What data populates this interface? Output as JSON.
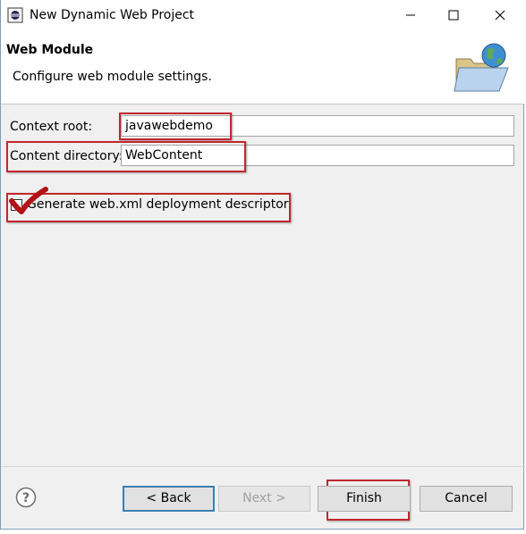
{
  "window": {
    "title": "New Dynamic Web Project"
  },
  "banner": {
    "title": "Web Module",
    "description": "Configure web module settings."
  },
  "form": {
    "context_root_label": "Context root:",
    "context_root_value": "javawebdemo",
    "content_directory_label": "Content directory:",
    "content_directory_value": "WebContent",
    "generate_xml_label": "Generate web.xml deployment descriptor",
    "generate_xml_checked": true
  },
  "buttons": {
    "back": "< Back",
    "next": "Next >",
    "finish": "Finish",
    "cancel": "Cancel"
  },
  "icons": {
    "app": "eclipse-icon",
    "minimize": "minimize-icon",
    "maximize": "maximize-icon",
    "close": "close-icon",
    "banner": "folder-globe-icon",
    "help": "help-icon"
  },
  "colors": {
    "annotation_red": "#c0272d",
    "check_red": "#b31217",
    "focus_blue": "#3c7fb1"
  }
}
